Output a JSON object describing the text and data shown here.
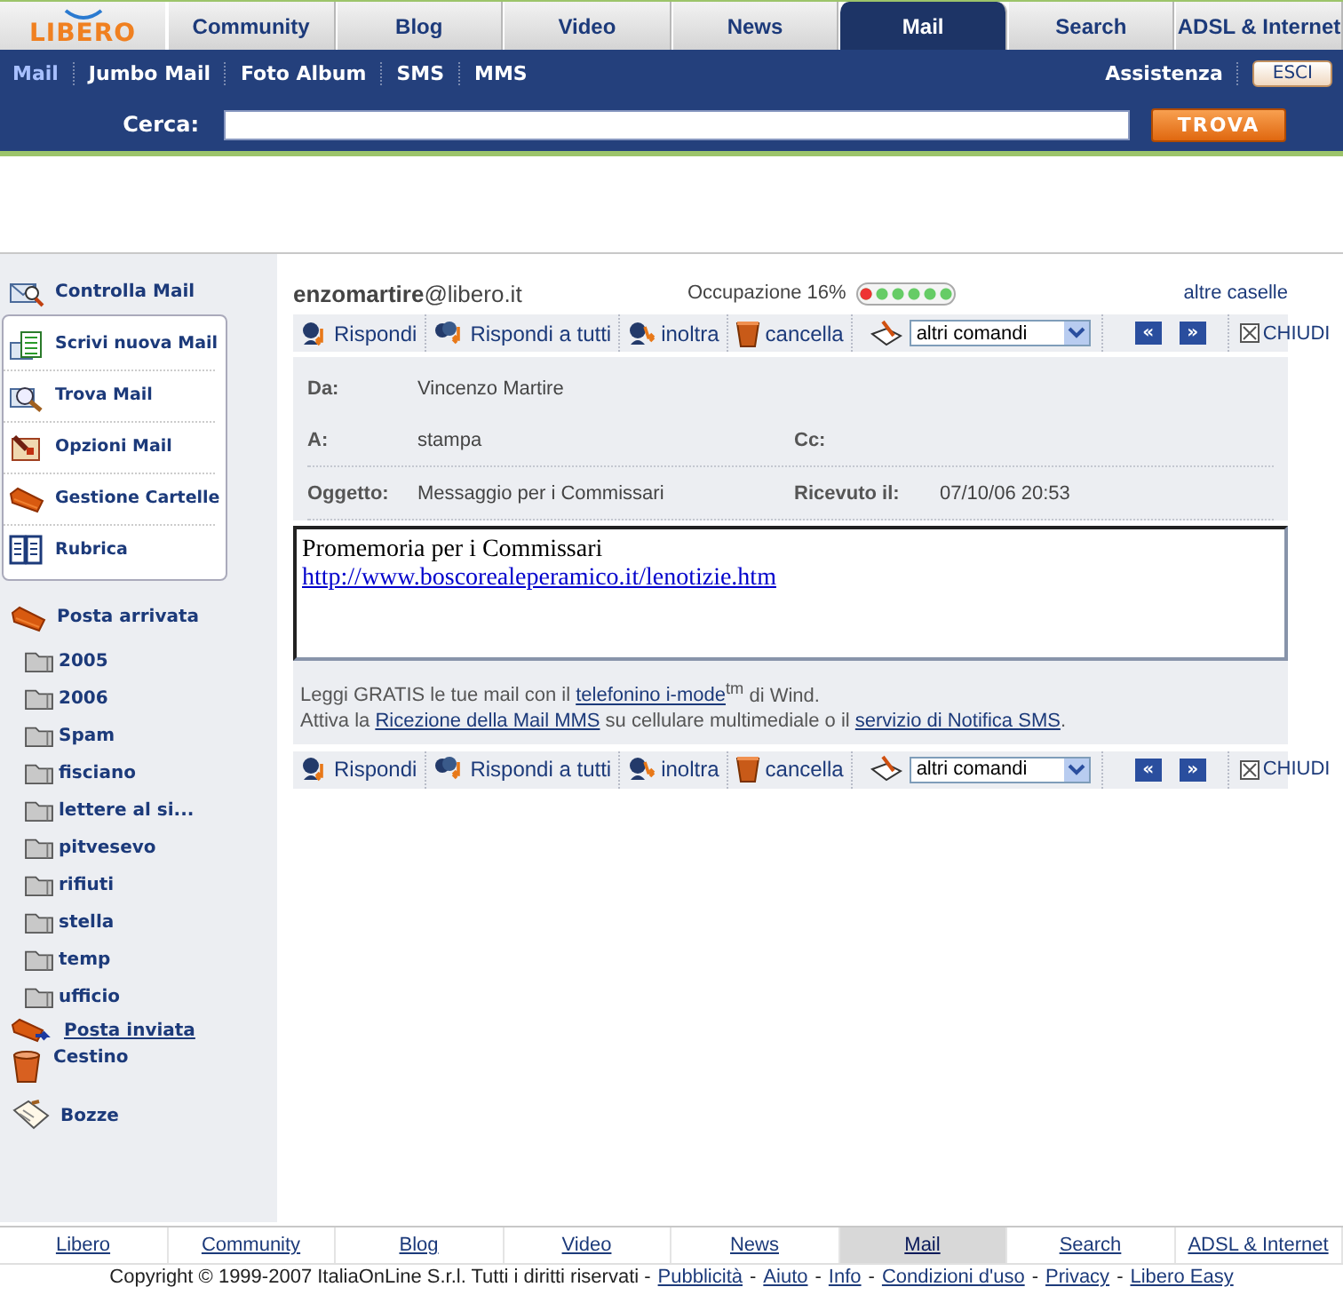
{
  "brand": {
    "logo": "LIBERO"
  },
  "top_tabs": [
    {
      "label": "Community",
      "selected": false
    },
    {
      "label": "Blog",
      "selected": false
    },
    {
      "label": "Video",
      "selected": false
    },
    {
      "label": "News",
      "selected": false
    },
    {
      "label": "Mail",
      "selected": true
    },
    {
      "label": "Search",
      "selected": false
    },
    {
      "label": "ADSL & Internet",
      "selected": false
    }
  ],
  "sub_nav": [
    {
      "label": "Mail",
      "selected": true
    },
    {
      "label": "Jumbo Mail",
      "selected": false
    },
    {
      "label": "Foto Album",
      "selected": false
    },
    {
      "label": "SMS",
      "selected": false
    },
    {
      "label": "MMS",
      "selected": false
    }
  ],
  "help_link": "Assistenza",
  "logout_button": "ESCI",
  "search": {
    "label": "Cerca:",
    "button": "TROVA"
  },
  "sidebar": {
    "check_mail": "Controlla Mail",
    "tools": [
      "Scrivi nuova Mail",
      "Trova Mail",
      "Opzioni Mail",
      "Gestione Cartelle",
      "Rubrica"
    ],
    "folders": [
      {
        "label": "Posta arrivata",
        "children": [
          {
            "label": "2005"
          },
          {
            "label": "2006"
          },
          {
            "label": "Spam"
          },
          {
            "label": "fisciano"
          },
          {
            "label": "lettere al si..."
          },
          {
            "label": "pitvesevo"
          },
          {
            "label": "rifiuti"
          },
          {
            "label": "stella"
          },
          {
            "label": "temp"
          },
          {
            "label": "ufficio"
          }
        ]
      },
      {
        "label": "Posta inviata"
      },
      {
        "label": "Cestino"
      },
      {
        "label": "Bozze"
      }
    ]
  },
  "account": {
    "user": "enzomartire",
    "domain": "@libero.it",
    "usage": "Occupazione 16%",
    "level": 0.16,
    "other_boxes": "altre caselle"
  },
  "toolbars": [
    {
      "actions": [
        "Rispondi",
        "Rispondi a tutti",
        "inoltra",
        "cancella"
      ],
      "menu": "altri comandi",
      "prev": "«",
      "next": "»",
      "close": "CHIUDI"
    },
    {
      "actions": [
        "Rispondi",
        "Rispondi a tutti",
        "inoltra",
        "cancella"
      ],
      "menu": "altri comandi",
      "prev": "«",
      "next": "»",
      "close": "CHIUDI"
    }
  ],
  "header_rows": [
    [
      {
        "label": "Da:",
        "value": "Vincenzo Martire"
      }
    ],
    [
      {
        "label": "A:",
        "value": "stampa"
      },
      {
        "label": "Cc:"
      }
    ],
    [
      {
        "label": "Oggetto:",
        "value": "Messaggio per i Commissari"
      },
      {
        "label": "Ricevuto il:",
        "value": "07/10/06 20:53"
      }
    ]
  ],
  "body": {
    "text": "Promemoria per i Commissari",
    "link": "http://www.boscorealeperamico.it/lenotizie.htm"
  },
  "promo": [
    [
      {
        "text": "Leggi GRATIS le tue mail con il "
      },
      {
        "text": "telefonino i-mode",
        "link": true
      },
      {
        "text": "$^{tm}$ di Wind."
      }
    ],
    [
      {
        "text": "Attiva la "
      },
      {
        "text": "Ricezione della Mail MMS",
        "link": true
      },
      {
        "text": " su cellulare multimediale o il "
      },
      {
        "text": "servizio di Notifica SMS",
        "link": true
      },
      {
        "text": "."
      }
    ]
  ],
  "footer_nav": [
    {
      "label": "Libero",
      "selected": false
    },
    {
      "label": "Community",
      "selected": false
    },
    {
      "label": "Blog",
      "selected": false
    },
    {
      "label": "Video",
      "selected": false
    },
    {
      "label": "News",
      "selected": false
    },
    {
      "label": "Mail",
      "selected": true
    },
    {
      "label": "Search",
      "selected": false
    },
    {
      "label": "ADSL & Internet",
      "selected": false
    }
  ],
  "legal_line": [
    {
      "kind": "text",
      "text": "Copyright © 1999-2007 ItaliaOnLine S.r.l. Tutti i diritti riservati -"
    },
    {
      "kind": "link",
      "text": "Pubblicità"
    },
    {
      "kind": "text",
      "text": "-"
    },
    {
      "kind": "link",
      "text": "Aiuto"
    },
    {
      "kind": "text",
      "text": "-"
    },
    {
      "kind": "link",
      "text": "Info"
    },
    {
      "kind": "text",
      "text": "-"
    },
    {
      "kind": "link",
      "text": "Condizioni d'uso"
    },
    {
      "kind": "text",
      "text": "-"
    },
    {
      "kind": "link",
      "text": "Privacy"
    },
    {
      "kind": "text",
      "text": "-"
    },
    {
      "kind": "link",
      "text": "Libero Easy"
    }
  ]
}
